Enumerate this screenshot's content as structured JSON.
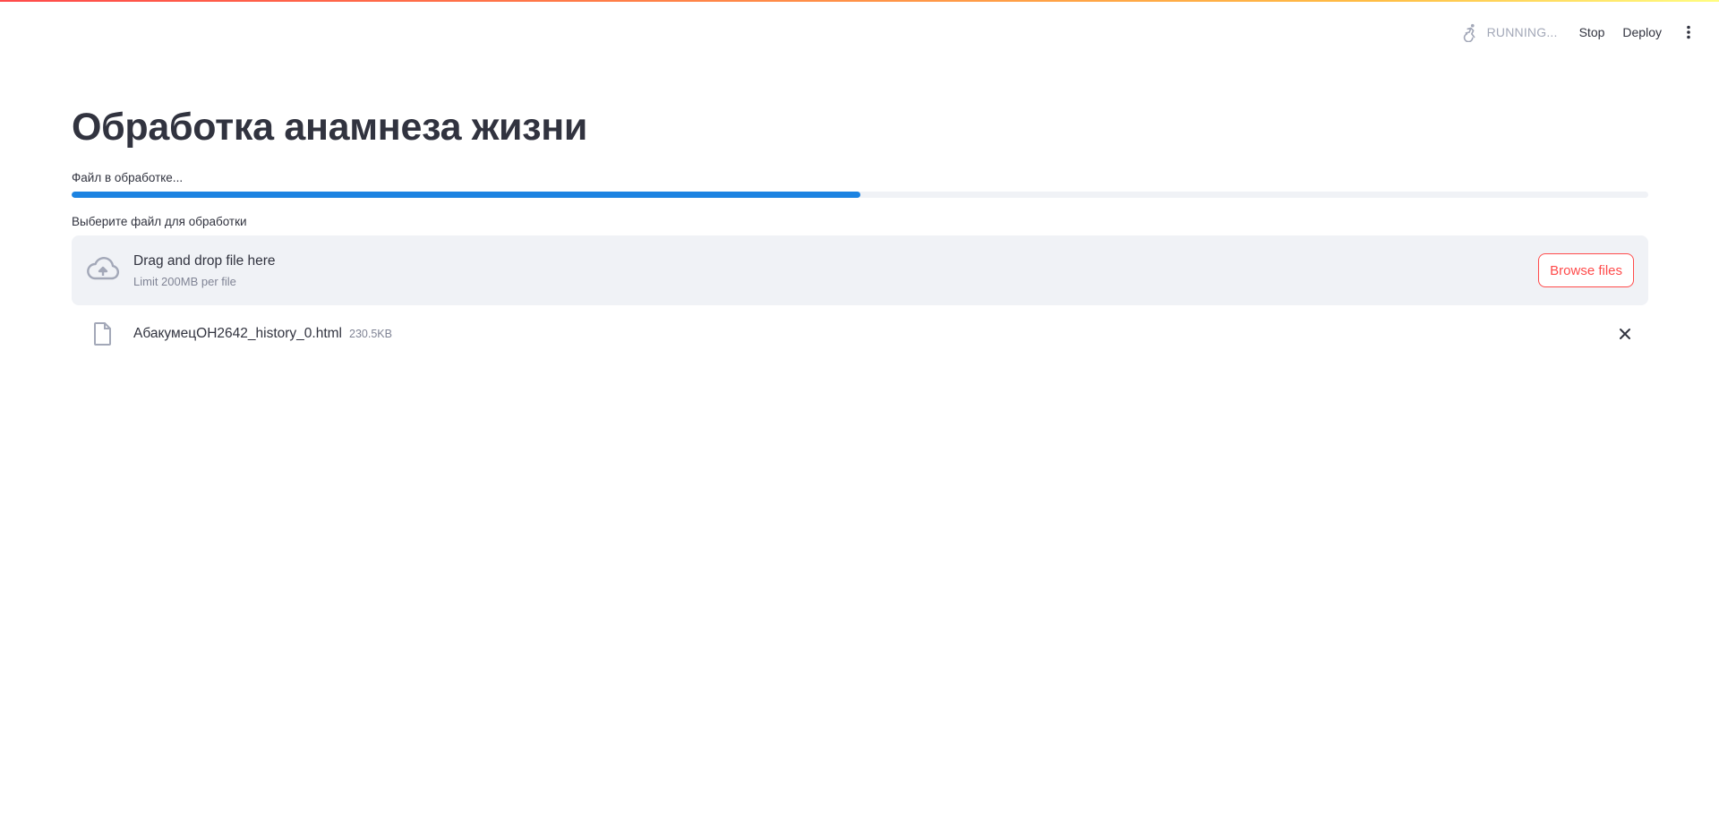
{
  "toolbar": {
    "status_text": "RUNNING...",
    "stop_label": "Stop",
    "deploy_label": "Deploy",
    "status_icon": "running-figure-icon",
    "menu_icon": "kebab-menu-icon"
  },
  "page": {
    "title": "Обработка анамнеза жизни"
  },
  "progress": {
    "label": "Файл в обработке...",
    "fraction": 0.5,
    "color": "#1c83e1"
  },
  "uploader": {
    "label": "Выберите файл для обработки",
    "drop_title": "Drag and drop file here",
    "limit_text": "Limit 200MB per file",
    "browse_label": "Browse files",
    "upload_icon": "cloud-upload-icon"
  },
  "file": {
    "name": "АбакумецОН2642_history_0.html",
    "size": "230.5KB",
    "icon": "file-icon",
    "remove_icon": "close-icon"
  },
  "colors": {
    "accent": "#ff4b4b",
    "text": "#31333f",
    "muted": "#808495"
  }
}
